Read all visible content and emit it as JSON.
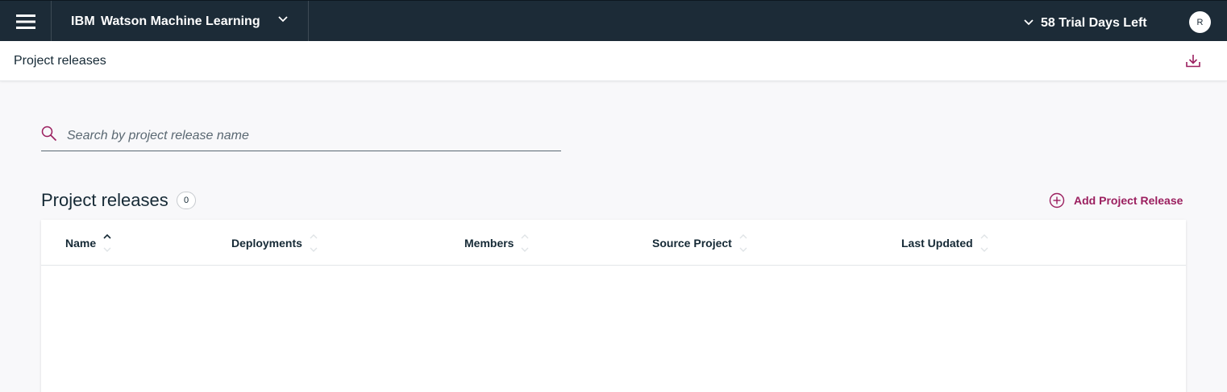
{
  "topbar": {
    "menu_icon": "hamburger-menu-icon",
    "brand": {
      "company": "IBM",
      "product": "Watson Machine Learning"
    },
    "trial_text": "58 Trial Days Left",
    "avatar_initial": "R",
    "background": "#1c2b37"
  },
  "subheader": {
    "title": "Project releases",
    "download_icon": "download-icon"
  },
  "search": {
    "placeholder": "Search by project release name",
    "value": ""
  },
  "section": {
    "title": "Project releases",
    "count": "0",
    "add_label": "Add Project Release"
  },
  "table": {
    "columns": [
      {
        "label": "Name",
        "sort": "ascending"
      },
      {
        "label": "Deployments",
        "sort": "none"
      },
      {
        "label": "Members",
        "sort": "none"
      },
      {
        "label": "Source Project",
        "sort": "none"
      },
      {
        "label": "Last Updated",
        "sort": "none"
      }
    ],
    "rows": []
  },
  "colors": {
    "accent": "#9b1f5f",
    "text": "#152935",
    "page_background": "#f8f8fa"
  }
}
